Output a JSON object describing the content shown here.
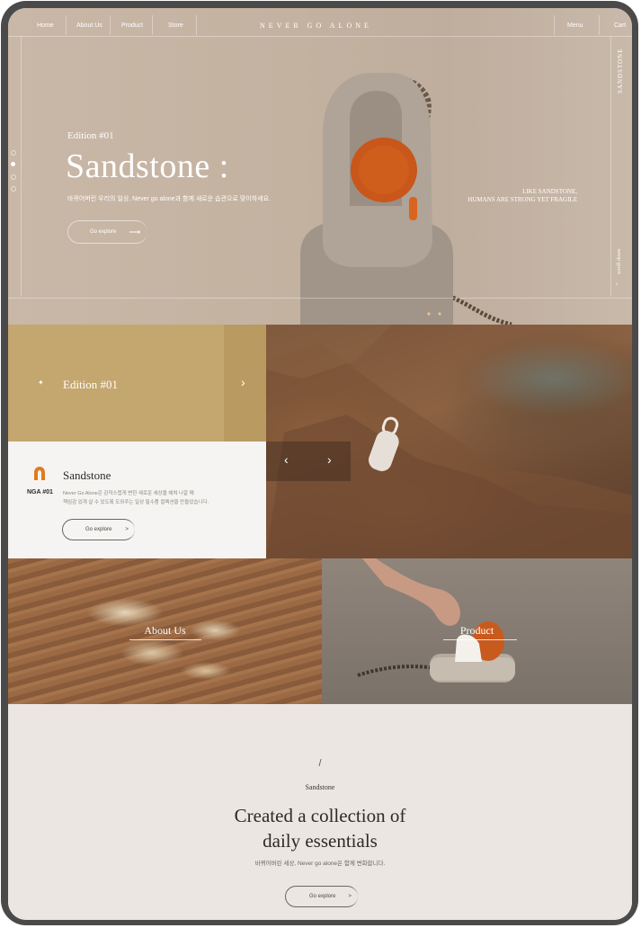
{
  "nav": {
    "items": [
      "Home",
      "About Us",
      "Product",
      "Store"
    ],
    "brand": "NEVER GO ALONE",
    "menu": "Menu",
    "cart": "Cart"
  },
  "hero": {
    "edition": "Edition #01",
    "title": "Sandstone :",
    "description": "바뀌어버린 우리의 일상, Never go alone과 함께 새로운 습관으로 맞이하세요.",
    "button": "Go explore",
    "tagline_1": "LIKE SANDSTONE,",
    "tagline_2": "HUMANS ARE STRONG YET FRAGILE",
    "side_label": "SANDSTONE",
    "scroll_label": "scroll down"
  },
  "edition_panel": {
    "label": "Edition #01"
  },
  "product_card": {
    "code": "NGA #01",
    "name": "Sandstone",
    "description_1": "Never Go Alone은 감작스럽게 변한 새로운 세상을 헤쳐 나갈 때",
    "description_2": "책임감 있게 살 수 있도록 도와주는 일상 필수품 컬렉션을 만들었습니다.",
    "button": "Go explore",
    "button_arrow": ">"
  },
  "tiles": {
    "about": "About Us",
    "product": "Product"
  },
  "bottom": {
    "slash": "/",
    "kicker": "Sandstone",
    "headline_1": "Created a collection of",
    "headline_2": "daily essentials",
    "subtext": "바뀌어버린 세상, Never go alone은 함께 변화합니다.",
    "button": "Go explore",
    "button_arrow": ">"
  },
  "colors": {
    "device": "#4a4a4a",
    "hero_bg": "#c4b2a1",
    "gold": "#c4a66f",
    "gold_dark": "#b99a61",
    "accent_orange": "#d9641f",
    "bottom_bg": "#ebe6e1"
  }
}
